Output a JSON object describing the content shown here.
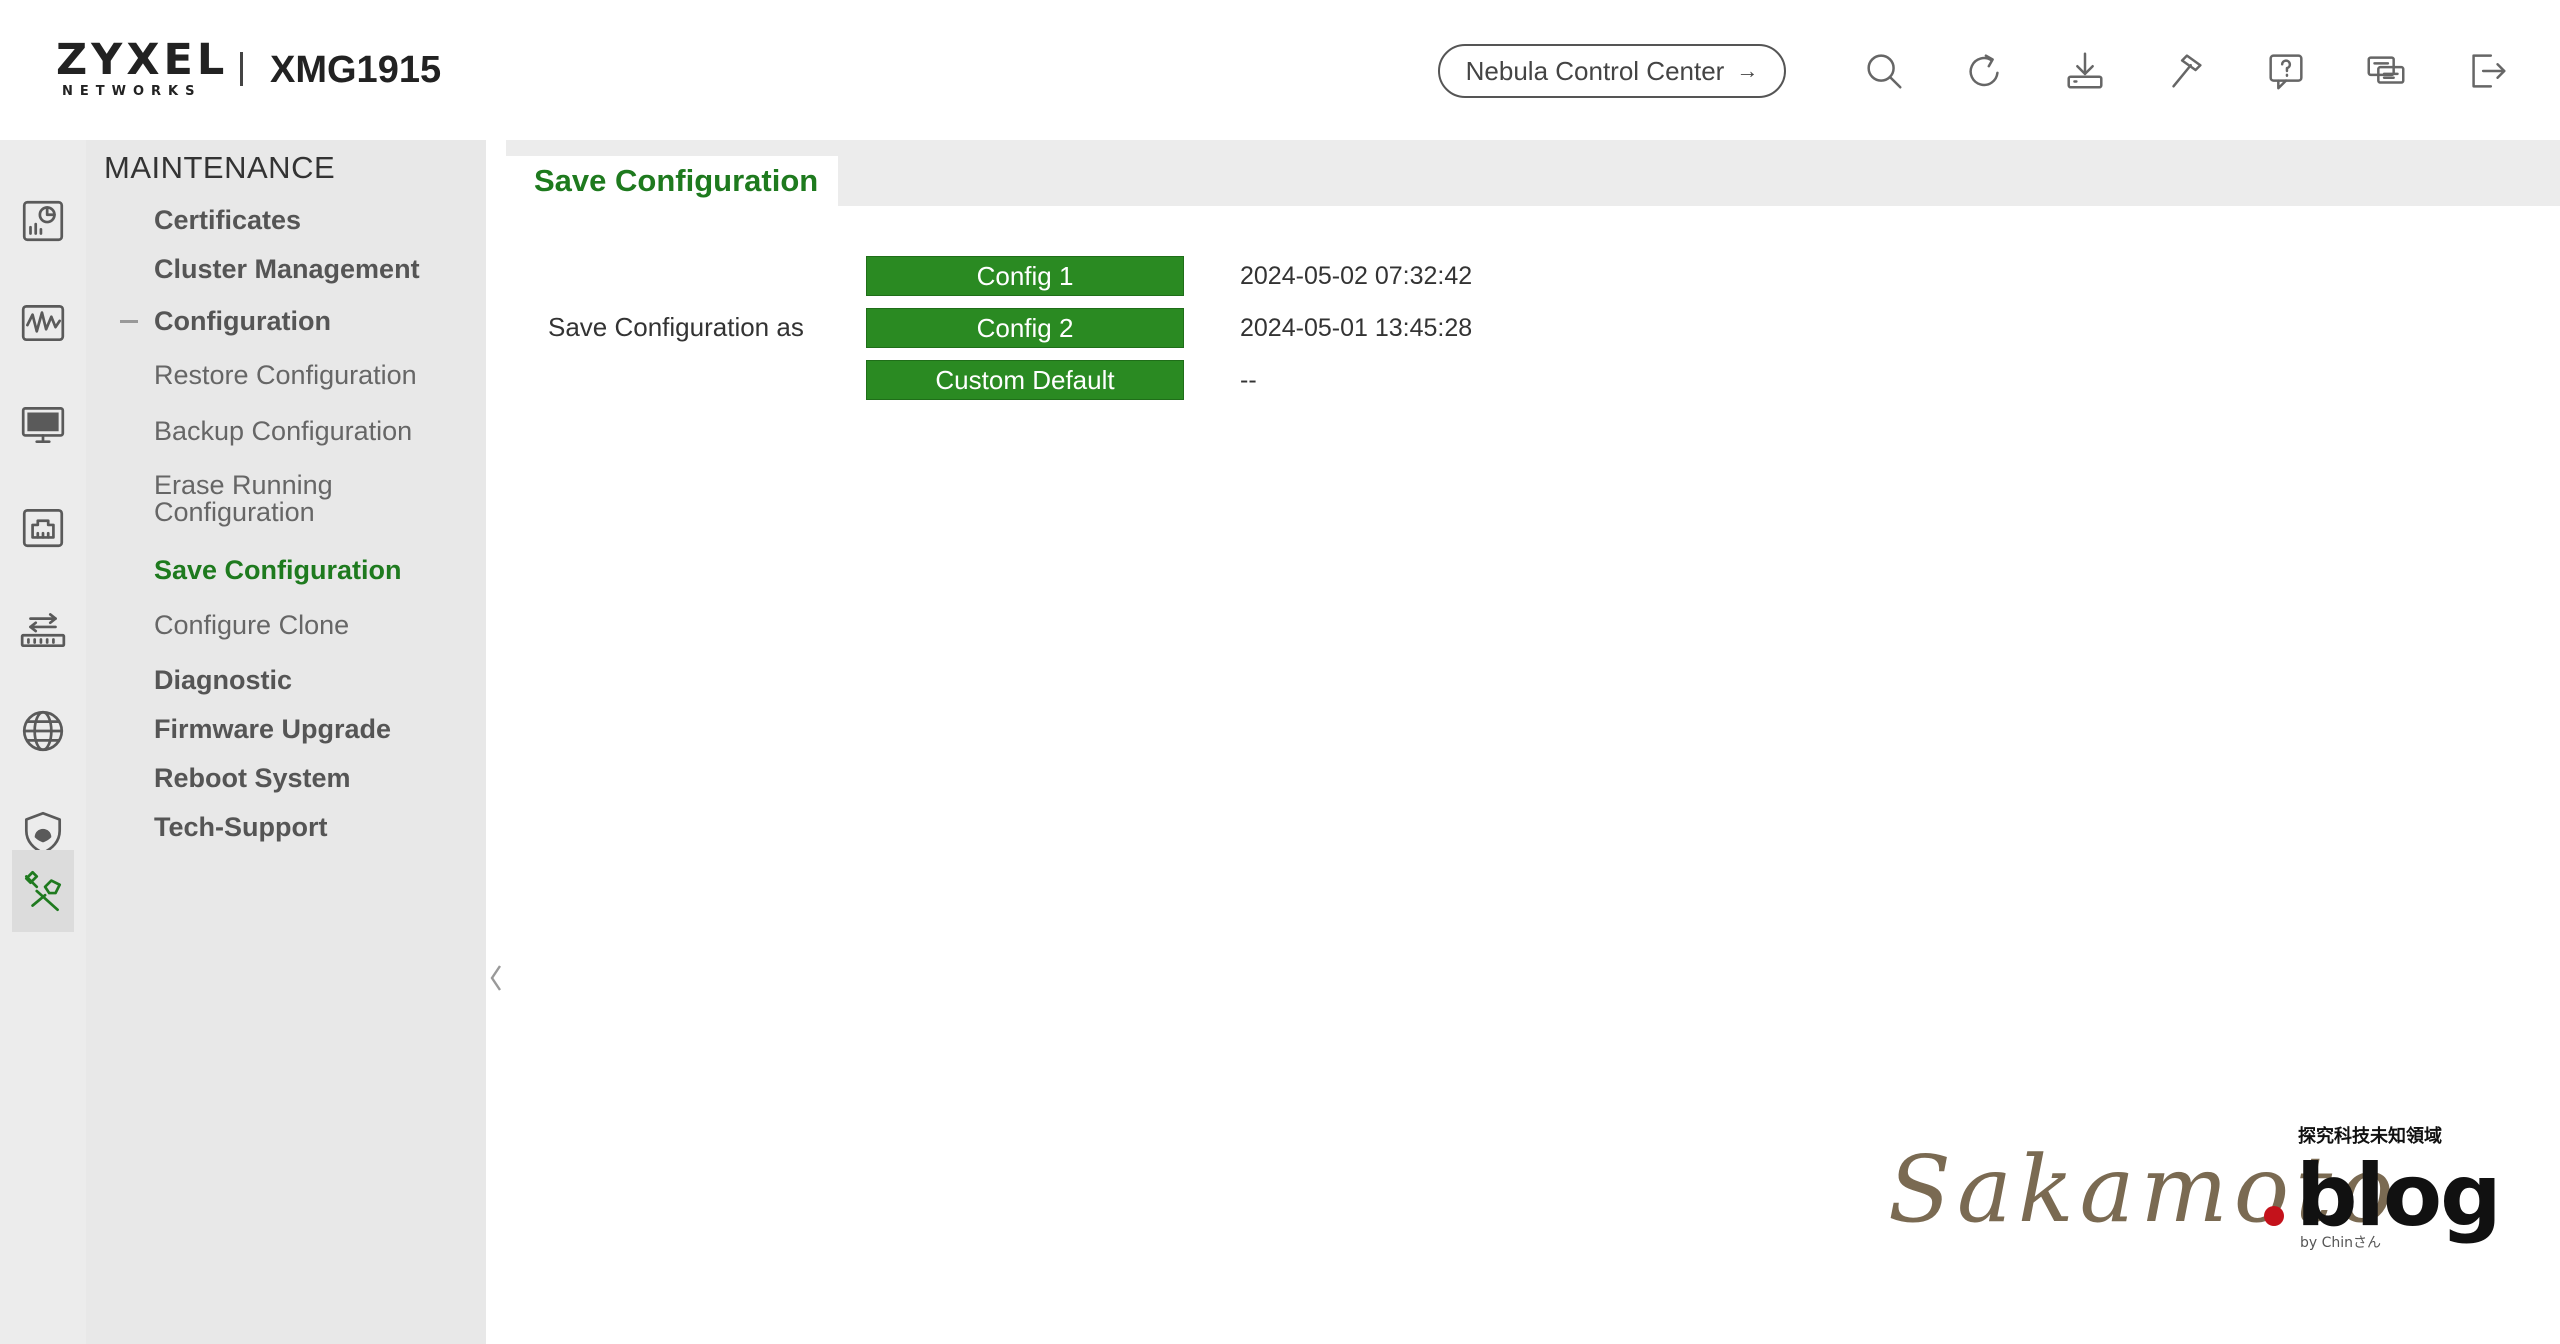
{
  "header": {
    "brand": "ZYXEL",
    "brand_sub": "NETWORKS",
    "model": "XMG1915",
    "nebula_button": "Nebula Control Center",
    "nebula_arrow": "→",
    "toolbar_icons": [
      "search-icon",
      "refresh-icon",
      "save-download-icon",
      "tools-icon",
      "help-icon",
      "feedback-icon",
      "logout-icon"
    ]
  },
  "rail": {
    "icons": [
      "dashboard-icon",
      "monitor-waveform-icon",
      "system-display-icon",
      "port-icon",
      "switching-icon",
      "network-globe-icon",
      "security-shield-icon",
      "maintenance-tools-icon"
    ],
    "active": "maintenance-tools-icon"
  },
  "menu": {
    "title": "MAINTENANCE",
    "items": {
      "certificates": "Certificates",
      "cluster": "Cluster Management",
      "configuration": "Configuration",
      "restore": "Restore Configuration",
      "backup": "Backup Configuration",
      "erase_line1": "Erase Running",
      "erase_line2": "Configuration",
      "save": "Save Configuration",
      "clone": "Configure Clone",
      "diagnostic": "Diagnostic",
      "firmware": "Firmware Upgrade",
      "reboot": "Reboot System",
      "techsupport": "Tech-Support"
    },
    "selected": "Save Configuration"
  },
  "main": {
    "tab": "Save Configuration",
    "row_label": "Save Configuration as",
    "configs": [
      {
        "label": "Config 1",
        "time": "2024-05-02 07:32:42"
      },
      {
        "label": "Config 2",
        "time": "2024-05-01 13:45:28"
      },
      {
        "label": "Custom Default",
        "time": "--"
      }
    ]
  },
  "watermark": {
    "script": "Sakamoto",
    "blog": "blog",
    "tagline": "探究科技未知領域",
    "by": "by Chinさん"
  },
  "colors": {
    "accent_green": "#1e7a1e",
    "button_green": "#2a8a22",
    "sidebar_bg": "#e8e8e8",
    "rail_bg": "#ececec"
  }
}
